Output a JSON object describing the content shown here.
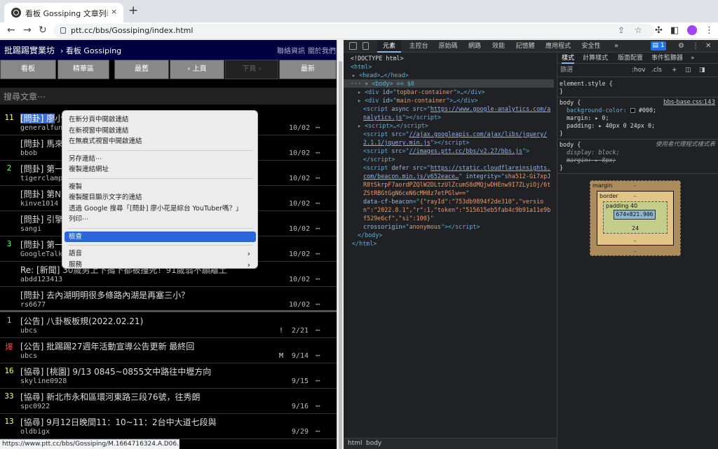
{
  "browser": {
    "tab_title": "看板 Gossiping 文章列表 - 批踢…",
    "tab_close": "×",
    "new_tab": "+",
    "url": "ptt.cc/bbs/Gossiping/index.html",
    "status_url": "https://www.ptt.cc/bbs/Gossiping/M.1664716324.A.D06.html"
  },
  "ptt": {
    "site_name": "批踢踢實業坊",
    "board_crumb": "› 看板 Gossiping",
    "contact": "聯絡資訊",
    "about": "關於我們",
    "nav": [
      "看板",
      "精華區",
      "最舊",
      "‹ 上頁",
      "下頁 ›",
      "最新"
    ],
    "search_placeholder": "搜尋文章⋯",
    "more": "⋯",
    "posts": [
      {
        "push": "11",
        "push_color": "#ffff66",
        "title": "[問卦] 廖小花是綜台YouTuber嗎？",
        "author": "generalfun",
        "mark": "",
        "date": "10/02"
      },
      {
        "push": "",
        "push_color": "#ffffff",
        "title": "[問卦] 馬來",
        "author": "bbob",
        "mark": "",
        "date": "10/02"
      },
      {
        "push": "2",
        "push_color": "#66ff66",
        "title": "[問卦] 第一",
        "author": "tigerclamp",
        "mark": "",
        "date": "10/02"
      },
      {
        "push": "",
        "push_color": "#ffffff",
        "title": "[問卦] 第N",
        "author": "kinve1014",
        "mark": "",
        "date": "10/02"
      },
      {
        "push": "",
        "push_color": "#ffffff",
        "title": "[問卦] 引擎",
        "author": "sangi",
        "mark": "",
        "date": "10/02"
      },
      {
        "push": "3",
        "push_color": "#66ff66",
        "title": "[問卦] 第一",
        "author": "GoogleTalk",
        "mark": "",
        "date": "10/02"
      },
      {
        "push": "",
        "push_color": "#ffffff",
        "title": "Re: [新聞] 30歲男上下搗下都被撞死！91歲翁不願離土",
        "author": "abdd123413",
        "mark": "",
        "date": "10/02"
      },
      {
        "push": "",
        "push_color": "#ffffff",
        "title": "[問卦] 去內湖明明很多條路內湖是再塞三小？",
        "author": "rs6677",
        "mark": "",
        "date": "10/02"
      }
    ],
    "pinned": [
      {
        "push": "1",
        "push_color": "#66ff66",
        "title": "[公告] 八卦板板規(2022.02.21)",
        "author": "ubcs",
        "mark": "!",
        "date": "2/21"
      },
      {
        "push": "爆",
        "push_color": "#ff4444",
        "title": "[公告] 批踢踢27週年活動宣導公告更新 最終回",
        "author": "ubcs",
        "mark": "M",
        "date": "9/14"
      },
      {
        "push": "16",
        "push_color": "#ffff66",
        "title": "[協尋] [桃園] 9/13 0845~0855文中路往中壢方向",
        "author": "skyline0928",
        "mark": "",
        "date": "9/15"
      },
      {
        "push": "33",
        "push_color": "#ffff66",
        "title": "[協尋] 新北市永和區環河東路三段76號，往秀朗",
        "author": "spc0922",
        "mark": "",
        "date": "9/16"
      },
      {
        "push": "13",
        "push_color": "#ffff66",
        "title": "[協尋] 9月12日晚間11：10~11：2台中大道七段與",
        "author": "oldbigx",
        "mark": "",
        "date": "9/29"
      }
    ]
  },
  "context_menu": {
    "groups": [
      [
        "在新分頁中開啟連結",
        "在新視窗中開啟連結",
        "在無痕式視窗中開啟連結"
      ],
      [
        "另存連結⋯",
        "複製連結網址"
      ],
      [
        "複製",
        "複製醒目顯示文字的連結",
        "透過 Google 搜尋「[問卦] 廖小花是綜台 YouTuber嗎？」",
        "列印⋯"
      ],
      [
        "檢查"
      ],
      [
        "語音",
        "服務"
      ]
    ],
    "active": "檢查",
    "submenu_arrow": "›"
  },
  "devtools": {
    "tabs": [
      "元素",
      "主控台",
      "原始碼",
      "網路",
      "效能",
      "記憶體",
      "應用程式",
      "安全性"
    ],
    "more": "»",
    "issues": "1",
    "gear": "⚙",
    "kebab": "⋮",
    "close": "✕",
    "dom": {
      "doctype": "<!DOCTYPE html>",
      "html_open": "<html>",
      "head": "<head>…</head>",
      "body": "<body> == $0",
      "div1_id": "topbar-container",
      "div2_id": "main-container",
      "script_ga": "https://www.google-analytics.com/analytics.js",
      "script_jq": "//ajax.googleapis.com/ajax/libs/jquery/2.1.1/jquery.min.js",
      "script_bbs": "//images.ptt.cc/bbs/v2.27/bbs.js",
      "script_cf": "https://static.cloudflareinsights.com/beacon.min.js/v652eace…",
      "integrity": "sha512-Gi7xpJR8tSkrpF7aordPZQlW2DLtzUlZcumS8dMQjwDHEnw9I7ZLyiOj/6tZStRBGtGgN6ceN6cMH8z7etPGlw==",
      "beacon": "{\"rayId\":\"753db9894f2de310\",\"version\":\"2022.8.1\",\"r\":1,\"token\":\"515615eb5fab4c9b91a11e9bf529e6cf\",\"si\":100}",
      "crossorigin": "anonymous",
      "body_close": "</body>",
      "html_close": "</html>"
    },
    "crumbs": [
      "html",
      "body"
    ],
    "styles": {
      "tabs": [
        "樣式",
        "計算樣式",
        "版面配置",
        "事件監聽器"
      ],
      "filter": "篩選",
      "hov": ":hov",
      "cls": ".cls",
      "element_style": "element.style {",
      "body_rule_src": "bbs-base.css:143",
      "body_bg": "background-color: ",
      "body_bg_val": "#000;",
      "body_margin": "margin: ▸ 0;",
      "body_padding": "padding: ▸ 40px 0 24px 0;",
      "ua_label": "使用者代理程式樣式表",
      "ua_display": "display: block;",
      "ua_margin": "margin: ▸ 8px;",
      "box_margin": "margin",
      "box_border": "border",
      "box_padding": "padding 40",
      "box_content": "674×821.906",
      "box_padding_bottom": "24",
      "dash": "-"
    }
  }
}
